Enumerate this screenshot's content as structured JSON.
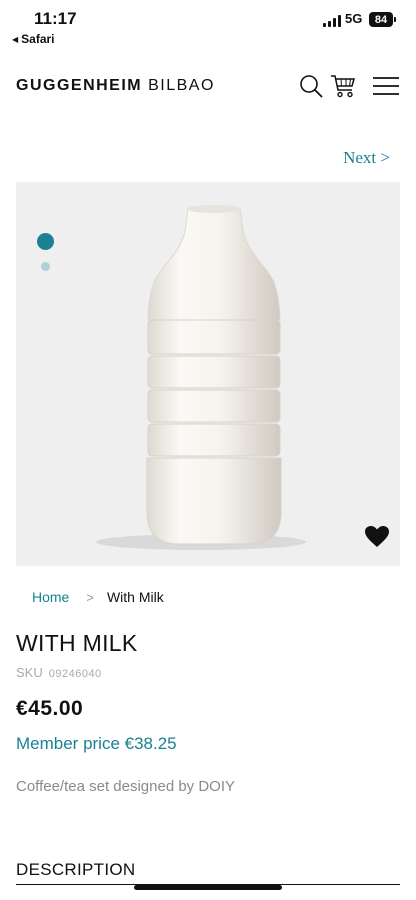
{
  "status_bar": {
    "time": "11:17",
    "back_label": "Safari",
    "network": "5G",
    "battery": "84"
  },
  "header": {
    "brand_bold": "GUGGENHEIM",
    "brand_light": "BILBAO",
    "icons": [
      "search-icon",
      "cart-icon",
      "menu-icon"
    ]
  },
  "pager": {
    "next_label": "Next >"
  },
  "gallery": {
    "image_count": 2,
    "active_index": 0,
    "favorite_icon": "heart-icon"
  },
  "breadcrumb": {
    "home": "Home",
    "separator": ">",
    "current": "With Milk"
  },
  "product": {
    "title": "WITH MILK",
    "sku_label": "SKU",
    "sku_value": "09246040",
    "price": "€45.00",
    "member_price": "Member price €38.25",
    "designer_note": "Coffee/tea set designed by DOIY"
  },
  "sections": {
    "description": "DESCRIPTION"
  },
  "colors": {
    "accent": "#1a8193",
    "dot_inactive": "#a9d2dc",
    "image_bg": "#efefef"
  }
}
